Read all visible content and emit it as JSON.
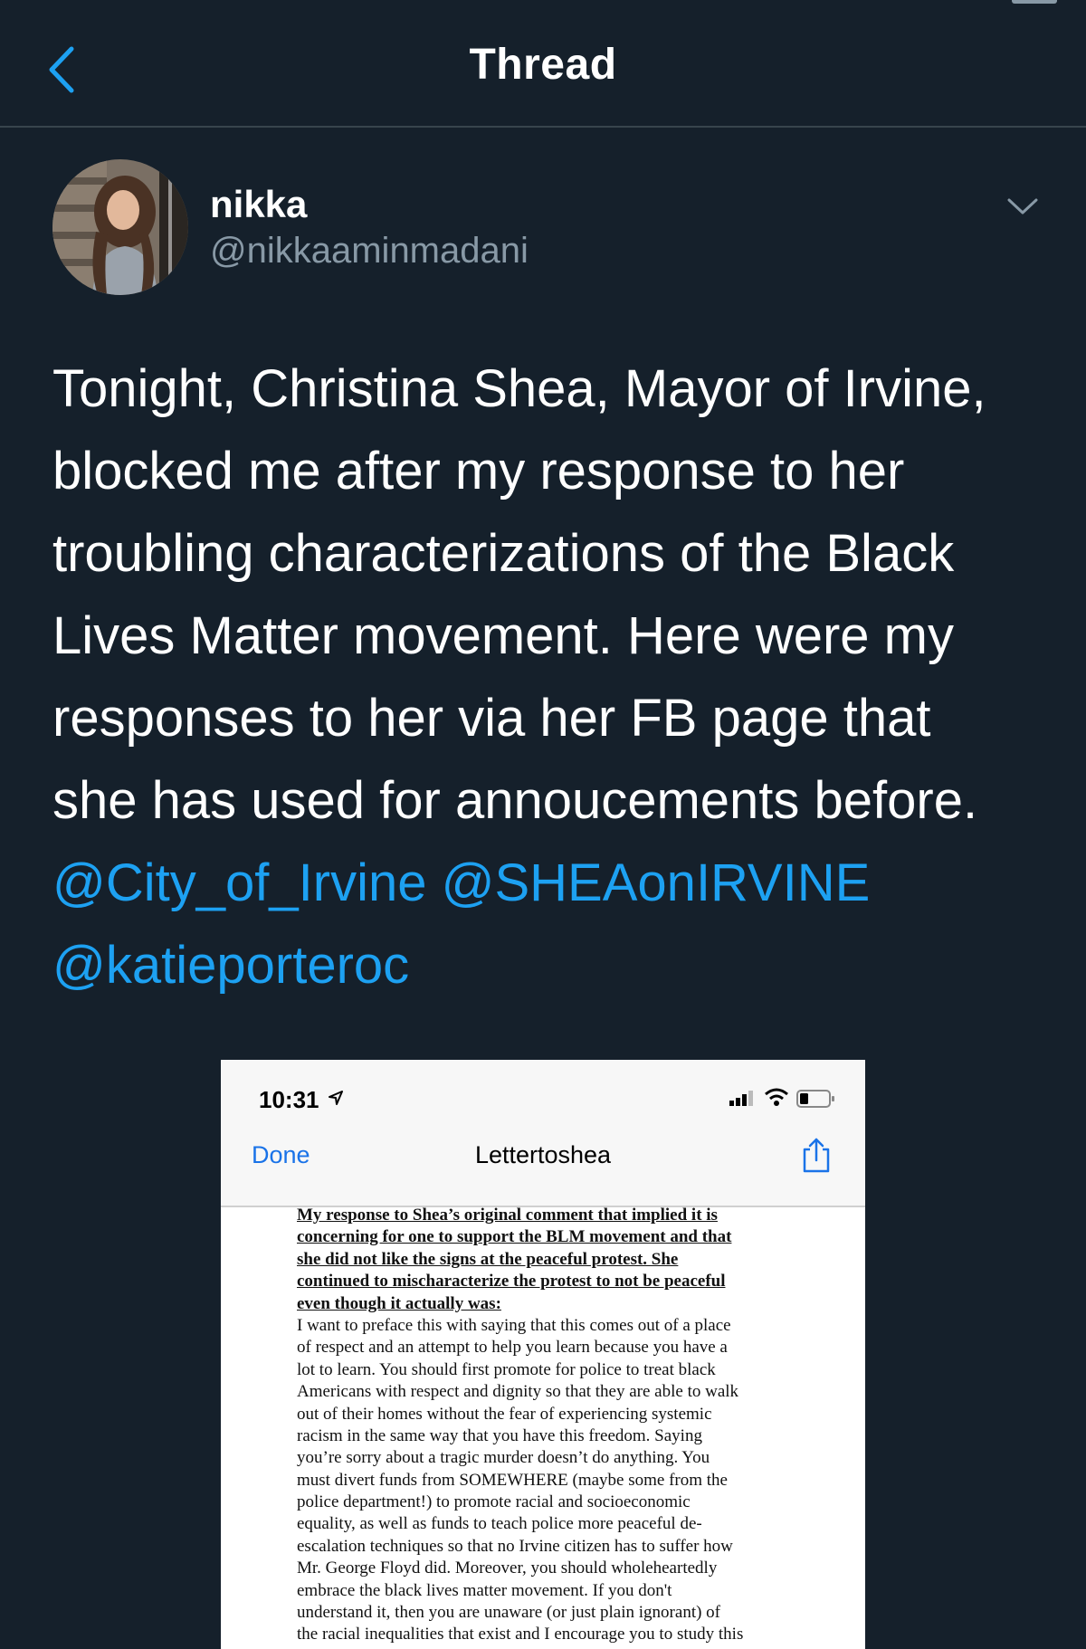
{
  "header": {
    "title": "Thread",
    "back_icon": "chevron-left-icon",
    "accent_color": "#1da1f2"
  },
  "author": {
    "name": "nikka",
    "handle": "@nikkaaminmadani",
    "menu_icon": "chevron-down-icon"
  },
  "tweet": {
    "lines": [
      "Tonight, Christina Shea, Mayor of Irvine,",
      "blocked me after my response to her",
      "troubling characterizations of the Black",
      "Lives Matter movement. Here were my",
      "responses to her via her FB page that",
      "she has used for annoucements before."
    ],
    "mentions": [
      "@City_of_Irvine",
      "@SHEAonIRVINE",
      "@katieporteroc"
    ]
  },
  "embedded_screenshot": {
    "status_bar": {
      "time": "10:31",
      "icons": [
        "location-arrow-icon",
        "signal-icon",
        "wifi-icon",
        "battery-icon"
      ]
    },
    "nav": {
      "done_label": "Done",
      "title": "Lettertoshea",
      "share_icon": "share-icon"
    },
    "document": {
      "heading_lines": [
        "My response to Shea’s original comment that implied it is",
        "concerning for one to support the BLM movement and that",
        "she did not like the signs at the peaceful protest. She",
        "continued to mischaracterize the protest to not be peaceful",
        "even though it actually was:"
      ],
      "body_lines": [
        "I want to preface this with saying that this comes out of a place",
        "of respect and an attempt to help you learn because you have a",
        "lot to learn. You should first promote for police to treat black",
        "Americans with respect and dignity so that they are able to walk",
        "out of their homes without the fear of experiencing systemic",
        "racism in the same way that you have this freedom. Saying",
        "you’re sorry about a tragic murder doesn’t do anything. You",
        "must divert funds from SOMEWHERE (maybe some from the",
        "police department!) to promote racial and socioeconomic",
        "equality, as well as funds to teach police more peaceful de-",
        "escalation techniques so that no Irvine citizen has to suffer how",
        "Mr. George Floyd did. Moreover, you should wholeheartedly",
        "embrace the black lives matter movement. If you don't",
        "understand it, then you are unaware (or just plain ignorant) of",
        "the racial inequalities that exist and I encourage you to study this"
      ]
    }
  }
}
